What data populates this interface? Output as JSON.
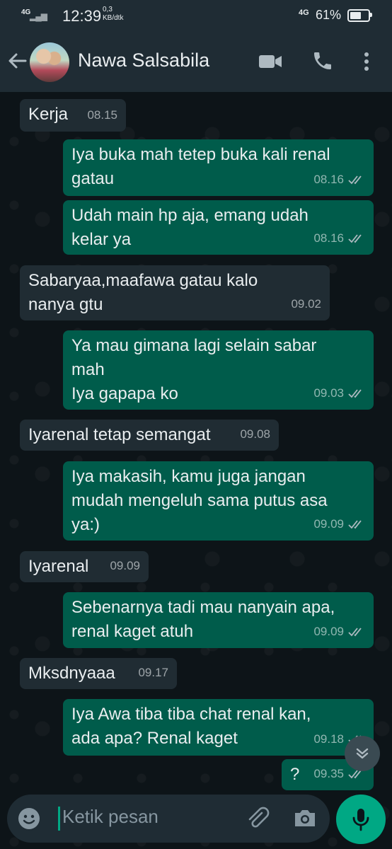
{
  "status_bar": {
    "network_left": "4G",
    "signal": "▂▄▆",
    "time": "12:39",
    "speed_value": "0,3",
    "speed_unit": "KB/dtk",
    "network_right": "4G",
    "battery_percent": "61%",
    "battery_level": 0.61
  },
  "header": {
    "contact_name": "Nawa Salsabila",
    "icons": [
      "back-arrow-icon",
      "video-call-icon",
      "phone-call-icon",
      "more-options-icon"
    ]
  },
  "messages": [
    {
      "dir": "in",
      "text": "Kerja",
      "time": "08.15"
    },
    {
      "dir": "out",
      "text": "Iya buka mah tetep buka kali renal\ngatau",
      "time": "08.16",
      "read": true
    },
    {
      "dir": "out",
      "text": "Udah main hp aja, emang udah\nkelar ya",
      "time": "08.16",
      "read": true
    },
    {
      "dir": "in",
      "text": "Sabaryaa,maafawa gatau kalo\nnanya gtu",
      "time": "09.02"
    },
    {
      "dir": "out",
      "text": "Ya mau gimana lagi selain sabar\nmah\nIya gapapa ko",
      "time": "09.03",
      "read": true
    },
    {
      "dir": "in",
      "text": "Iyarenal tetap semangat",
      "time": "09.08"
    },
    {
      "dir": "out",
      "text": "Iya makasih, kamu juga jangan\nmudah mengeluh sama putus asa\nya:)",
      "time": "09.09",
      "read": true
    },
    {
      "dir": "in",
      "text": "Iyarenal",
      "time": "09.09"
    },
    {
      "dir": "out",
      "text": "Sebenarnya tadi mau nanyain apa,\nrenal kaget atuh",
      "time": "09.09",
      "read": true
    },
    {
      "dir": "in",
      "text": "Mksdnyaaa",
      "time": "09.17"
    },
    {
      "dir": "out",
      "text": "Iya Awa tiba tiba chat renal kan,\nada apa? Renal kaget",
      "time": "09.18",
      "read": true
    },
    {
      "dir": "out",
      "text": "?",
      "time": "09.35",
      "read": true
    }
  ],
  "input": {
    "placeholder": "Ketik pesan"
  },
  "colors": {
    "incoming_bubble": "#202c33",
    "outgoing_bubble": "#005c4b",
    "accent": "#00a884",
    "header": "#1f2c34"
  }
}
